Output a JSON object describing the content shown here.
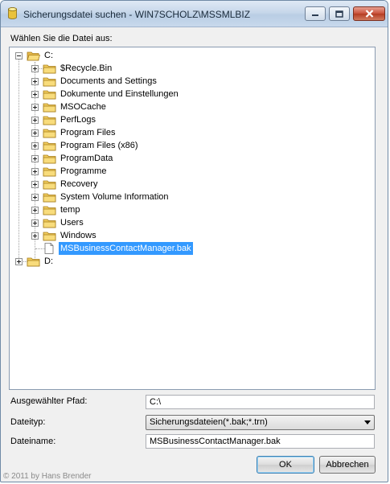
{
  "window": {
    "title": "Sicherungsdatei suchen - WIN7SCHOLZ\\MSSMLBIZ"
  },
  "prompt": "Wählen Sie die Datei aus:",
  "tree": {
    "drive_c": "C:",
    "drive_d": "D:",
    "folders": [
      "$Recycle.Bin",
      "Documents and Settings",
      "Dokumente und Einstellungen",
      "MSOCache",
      "PerfLogs",
      "Program Files",
      "Program Files (x86)",
      "ProgramData",
      "Programme",
      "Recovery",
      "System Volume Information",
      "temp",
      "Users",
      "Windows"
    ],
    "selected_file": "MSBusinessContactManager.bak"
  },
  "form": {
    "path_label": "Ausgewählter Pfad:",
    "path_value": "C:\\",
    "type_label": "Dateityp:",
    "type_value": "Sicherungsdateien(*.bak;*.trn)",
    "name_label": "Dateiname:",
    "name_value": "MSBusinessContactManager.bak"
  },
  "buttons": {
    "ok": "OK",
    "cancel": "Abbrechen"
  },
  "footer": {
    "copyright": "© 2011 by Hans Brender"
  }
}
